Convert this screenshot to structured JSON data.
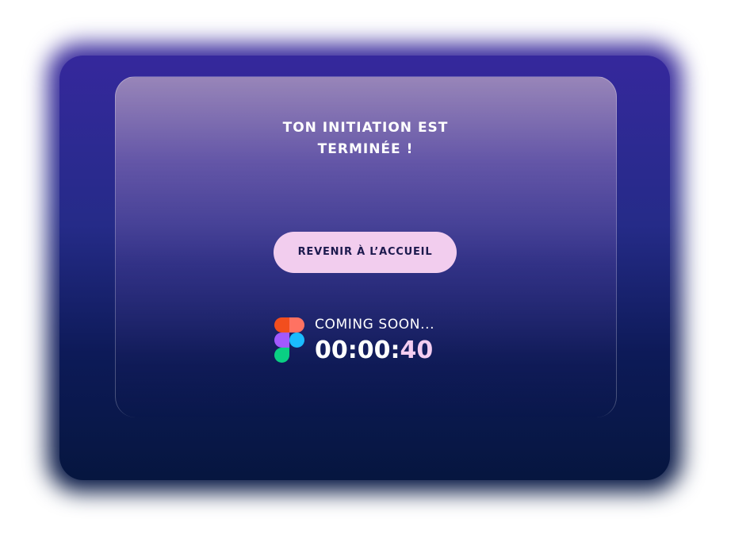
{
  "card": {
    "title_line1": "TON INITIATION EST",
    "title_line2": "TERMINÉE !"
  },
  "actions": {
    "home_button_label": "REVENIR À L’ACCUEIL"
  },
  "countdown": {
    "label": "COMING SOON...",
    "time_prefix": "00:00:",
    "time_seconds": "40",
    "icon": "figma-logo-icon"
  },
  "colors": {
    "button_bg": "#f2cdee",
    "button_text": "#1d1a4e",
    "seconds_accent": "#f4cdf0",
    "background_top": "#35289c",
    "background_bottom": "#06163f"
  }
}
